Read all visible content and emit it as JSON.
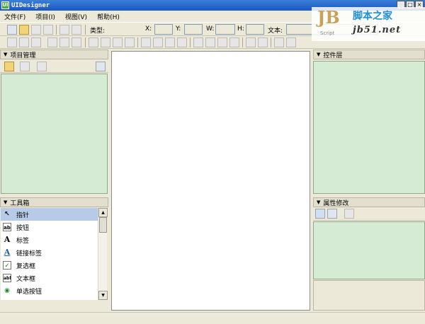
{
  "window": {
    "title": "UIDesigner",
    "app_icon": "UI"
  },
  "window_controls": {
    "minimize": "_",
    "maximize": "□",
    "close": "×"
  },
  "menu": [
    {
      "label": "文件(F)"
    },
    {
      "label": "项目(I)"
    },
    {
      "label": "视图(V)"
    },
    {
      "label": "帮助(H)"
    }
  ],
  "watermark": {
    "jb": "JB",
    "script": "Script",
    "cn": "脚本之家",
    "url": "jb51.net"
  },
  "toolbar": {
    "type_label": "类型:",
    "x_label": "X:",
    "y_label": "Y:",
    "w_label": "W:",
    "h_label": "H:",
    "text_label": "文本:"
  },
  "panels": {
    "project": "项目管理",
    "toolbox": "工具箱",
    "controls": "控件层",
    "properties": "属性修改"
  },
  "toolbox_items": [
    {
      "label": "指针",
      "icon": "pointer-icon",
      "glyph": "↖",
      "selected": true
    },
    {
      "label": "按钮",
      "icon": "button-icon",
      "glyph": "ab",
      "selected": false
    },
    {
      "label": "标签",
      "icon": "label-icon",
      "glyph": "A",
      "selected": false
    },
    {
      "label": "链接标签",
      "icon": "link-label-icon",
      "glyph": "A",
      "selected": false
    },
    {
      "label": "复选框",
      "icon": "checkbox-icon",
      "glyph": "✓",
      "selected": false
    },
    {
      "label": "文本框",
      "icon": "textbox-icon",
      "glyph": "abl",
      "selected": false
    },
    {
      "label": "单选按钮",
      "icon": "radio-icon",
      "glyph": "◉",
      "selected": false
    }
  ],
  "colors": {
    "title_bar": "#1b56c4",
    "panel_bg": "#d6ebd4",
    "selection": "#b7cbe8",
    "chrome": "#ece9d8"
  }
}
